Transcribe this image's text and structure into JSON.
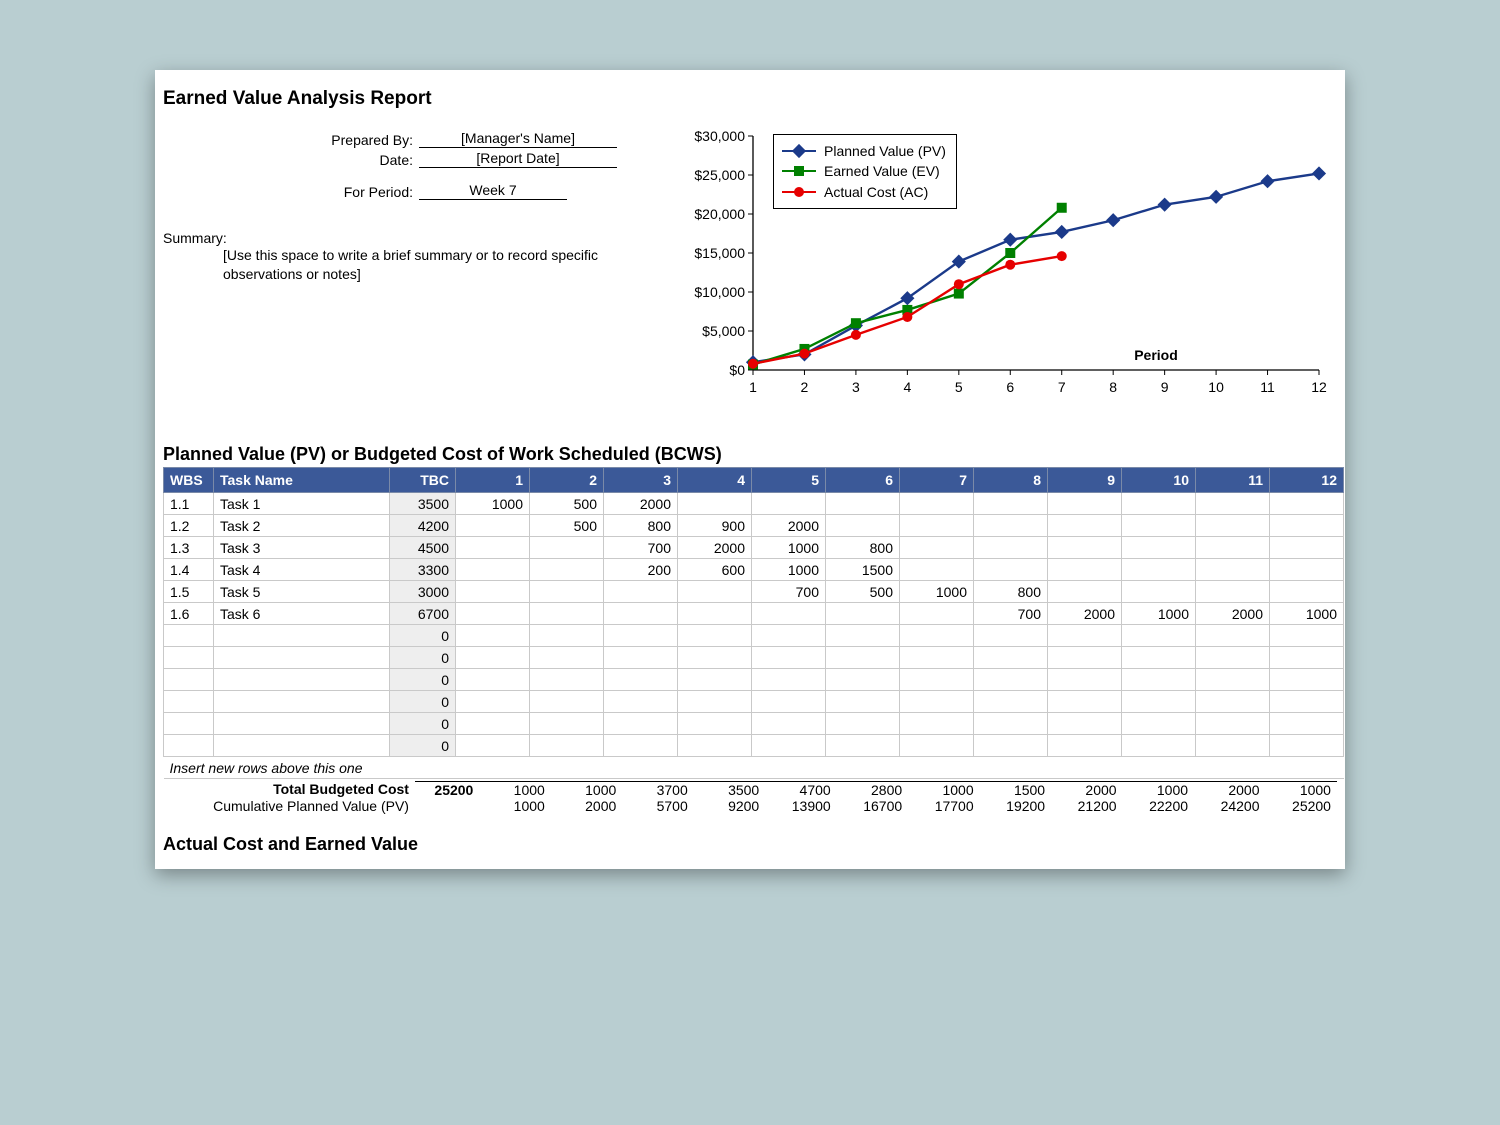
{
  "report_title": "Earned Value Analysis Report",
  "form": {
    "prepared_by_label": "Prepared By:",
    "prepared_by_value": "[Manager's Name]",
    "date_label": "Date:",
    "date_value": "[Report Date]",
    "period_label": "For Period:",
    "period_value": "Week 7",
    "summary_label": "Summary:",
    "summary_text": "[Use this space to write a brief summary or to record specific observations or notes]"
  },
  "chart_data": {
    "type": "line",
    "x": [
      1,
      2,
      3,
      4,
      5,
      6,
      7,
      8,
      9,
      10,
      11,
      12
    ],
    "xlabel": "Period",
    "ylabel": "",
    "ylim": [
      0,
      30000
    ],
    "yticks": [
      0,
      5000,
      10000,
      15000,
      20000,
      25000,
      30000
    ],
    "ytick_labels": [
      "$0",
      "$5,000",
      "$10,000",
      "$15,000",
      "$20,000",
      "$25,000",
      "$30,000"
    ],
    "series": [
      {
        "name": "Planned Value (PV)",
        "color": "#1b3a8a",
        "marker": "diamond",
        "values": [
          1000,
          2000,
          5700,
          9200,
          13900,
          16700,
          17700,
          19200,
          21200,
          22200,
          24200,
          25200
        ]
      },
      {
        "name": "Earned Value (EV)",
        "color": "#008000",
        "marker": "square",
        "values": [
          700,
          2700,
          6000,
          7700,
          9800,
          15000,
          20800
        ]
      },
      {
        "name": "Actual Cost (AC)",
        "color": "#e60000",
        "marker": "circle",
        "values": [
          800,
          2100,
          4500,
          6800,
          11000,
          13500,
          14600
        ]
      }
    ]
  },
  "section_pv_title": "Planned Value (PV) or Budgeted Cost of Work Scheduled (BCWS)",
  "pv_headers": {
    "wbs": "WBS",
    "task": "Task Name",
    "tbc": "TBC"
  },
  "periods": [
    "1",
    "2",
    "3",
    "4",
    "5",
    "6",
    "7",
    "8",
    "9",
    "10",
    "11",
    "12"
  ],
  "pv_rows": [
    {
      "wbs": "1.1",
      "task": "Task 1",
      "tbc": 3500,
      "vals": [
        1000,
        500,
        2000,
        "",
        "",
        "",
        "",
        "",
        "",
        "",
        "",
        ""
      ]
    },
    {
      "wbs": "1.2",
      "task": "Task 2",
      "tbc": 4200,
      "vals": [
        "",
        500,
        800,
        900,
        2000,
        "",
        "",
        "",
        "",
        "",
        "",
        ""
      ]
    },
    {
      "wbs": "1.3",
      "task": "Task 3",
      "tbc": 4500,
      "vals": [
        "",
        "",
        700,
        2000,
        1000,
        800,
        "",
        "",
        "",
        "",
        "",
        ""
      ]
    },
    {
      "wbs": "1.4",
      "task": "Task 4",
      "tbc": 3300,
      "vals": [
        "",
        "",
        200,
        600,
        1000,
        1500,
        "",
        "",
        "",
        "",
        "",
        ""
      ]
    },
    {
      "wbs": "1.5",
      "task": "Task 5",
      "tbc": 3000,
      "vals": [
        "",
        "",
        "",
        "",
        700,
        500,
        1000,
        800,
        "",
        "",
        "",
        ""
      ]
    },
    {
      "wbs": "1.6",
      "task": "Task 6",
      "tbc": 6700,
      "vals": [
        "",
        "",
        "",
        "",
        "",
        "",
        "",
        700,
        2000,
        1000,
        2000,
        1000
      ]
    },
    {
      "wbs": "",
      "task": "",
      "tbc": 0,
      "vals": [
        "",
        "",
        "",
        "",
        "",
        "",
        "",
        "",
        "",
        "",
        "",
        ""
      ]
    },
    {
      "wbs": "",
      "task": "",
      "tbc": 0,
      "vals": [
        "",
        "",
        "",
        "",
        "",
        "",
        "",
        "",
        "",
        "",
        "",
        ""
      ]
    },
    {
      "wbs": "",
      "task": "",
      "tbc": 0,
      "vals": [
        "",
        "",
        "",
        "",
        "",
        "",
        "",
        "",
        "",
        "",
        "",
        ""
      ]
    },
    {
      "wbs": "",
      "task": "",
      "tbc": 0,
      "vals": [
        "",
        "",
        "",
        "",
        "",
        "",
        "",
        "",
        "",
        "",
        "",
        ""
      ]
    },
    {
      "wbs": "",
      "task": "",
      "tbc": 0,
      "vals": [
        "",
        "",
        "",
        "",
        "",
        "",
        "",
        "",
        "",
        "",
        "",
        ""
      ]
    },
    {
      "wbs": "",
      "task": "",
      "tbc": 0,
      "vals": [
        "",
        "",
        "",
        "",
        "",
        "",
        "",
        "",
        "",
        "",
        "",
        ""
      ]
    }
  ],
  "pv_note": "Insert new rows above this one",
  "totals": {
    "budget_label": "Total Budgeted Cost",
    "budget_tbc": 25200,
    "budget_vals": [
      1000,
      1000,
      3700,
      3500,
      4700,
      2800,
      1000,
      1500,
      2000,
      1000,
      2000,
      1000
    ],
    "cum_label": "Cumulative Planned Value (PV)",
    "cum_vals": [
      1000,
      2000,
      5700,
      9200,
      13900,
      16700,
      17700,
      19200,
      21200,
      22200,
      24200,
      25200
    ]
  },
  "section_ac_title": "Actual Cost and Earned Value"
}
